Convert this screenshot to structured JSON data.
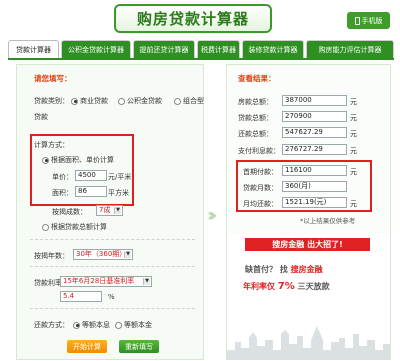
{
  "header": {
    "title": "购房贷款计算器",
    "mobile_label": "手机版"
  },
  "tabs": [
    {
      "label": "贷款计算器",
      "active": true
    },
    {
      "label": "公积金贷款计算器",
      "active": false
    },
    {
      "label": "提前还贷计算器",
      "active": false
    },
    {
      "label": "税费计算器",
      "active": false
    },
    {
      "label": "装修贷款计算器",
      "active": false
    },
    {
      "label": "购房能力评估计算器",
      "active": false
    }
  ],
  "form": {
    "section_title": "请您填写：",
    "loan_type_label": "贷款类别：",
    "loan_types": [
      "商业贷款",
      "公积金贷款",
      "组合型"
    ],
    "loan_type_wrap": "贷款",
    "calc_method_label": "计算方式：",
    "by_area_label": "根据面积、单价计算",
    "unit_price_label": "单价：",
    "unit_price_value": "4500",
    "unit_price_unit": "元/平米",
    "area_label": "面积：",
    "area_value": "86",
    "area_unit": "平方米",
    "mortgage_ratio_label": "按揭成数：",
    "mortgage_ratio_value": "7成",
    "by_total_label": "根据贷款总额计算",
    "years_label": "按揭年数：",
    "years_value": "30年（360期）",
    "rate_label": "贷款利率：",
    "rate_value": "15年6月28日基准利率",
    "rate_input": "5.4",
    "rate_unit": "%",
    "repay_label": "还款方式：",
    "repay_options": [
      "等额本息",
      "等额本金"
    ],
    "calc_button": "开始计算",
    "reset_button": "重新填写"
  },
  "results": {
    "section_title": "查看结果：",
    "rows_top": [
      {
        "label": "房款总额：",
        "value": "387000",
        "unit": "元"
      },
      {
        "label": "贷款总额：",
        "value": "270900",
        "unit": "元"
      },
      {
        "label": "还款总额：",
        "value": "547627.29",
        "unit": "元"
      },
      {
        "label": "支付利息款：",
        "value": "276727.29",
        "unit": "元"
      }
    ],
    "rows_boxed": [
      {
        "label": "首期付款：",
        "value": "116100",
        "unit": "元"
      },
      {
        "label": "贷款月数：",
        "value": "360(月)",
        "unit": ""
      },
      {
        "label": "月均还款：",
        "value": "1521.19(元)",
        "unit": "元"
      }
    ],
    "note": "*以上结果仅供参考"
  },
  "ad": {
    "banner": "搜房金融  出大招了!",
    "line1_a": "缺首付？",
    "line1_b": "找",
    "line1_c": "搜房金融",
    "line2_a": "年利率仅",
    "line2_b": "7%",
    "line2_c": "三天放款"
  },
  "colors": {
    "brand_green": "#2f8f23",
    "highlight_red": "#e02020",
    "accent_orange": "#f08a00"
  }
}
